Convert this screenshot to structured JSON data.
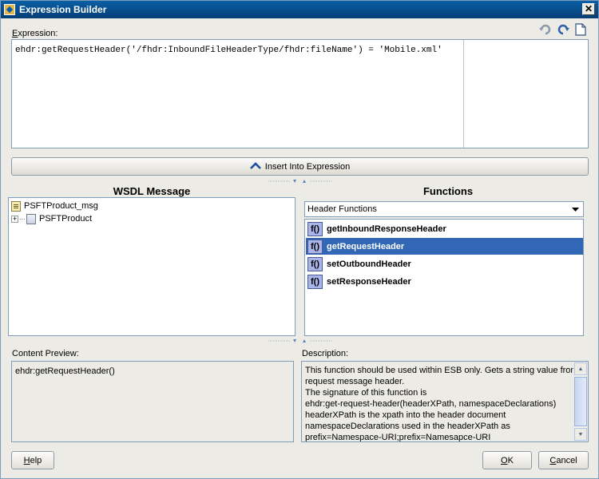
{
  "window": {
    "title": "Expression Builder",
    "close_glyph": "✕"
  },
  "expression": {
    "label": "Expression:",
    "value": "ehdr:getRequestHeader('/fhdr:InboundFileHeaderType/fhdr:fileName') = 'Mobile.xml'",
    "toolbar_icons": [
      "undo-icon",
      "redo-icon",
      "new-document-icon"
    ]
  },
  "insert_button": {
    "label": "Insert Into Expression",
    "icon": "chevron-up-icon"
  },
  "wsdl": {
    "title": "WSDL Message",
    "tree": [
      {
        "label": "PSFTProduct_msg",
        "icon": "message-icon"
      },
      {
        "label": "PSFTProduct",
        "icon": "part-icon",
        "expander": "+"
      }
    ]
  },
  "functions": {
    "title": "Functions",
    "category": "Header Functions",
    "fx_glyph": "f()",
    "items": [
      {
        "label": "getInboundResponseHeader",
        "selected": false
      },
      {
        "label": "getRequestHeader",
        "selected": true
      },
      {
        "label": "setOutboundHeader",
        "selected": false
      },
      {
        "label": "setResponseHeader",
        "selected": false
      }
    ]
  },
  "content_preview": {
    "label": "Content Preview:",
    "value": "ehdr:getRequestHeader()"
  },
  "description": {
    "label": "Description:",
    "lines": [
      "This function should be used within ESB only. Gets a string value from",
      "request message header.",
      "The signature of this function is",
      "ehdr:get-request-header(headerXPath, namespaceDeclarations)",
      " headerXPath is the xpath into the header document",
      " namespaceDeclarations used in the headerXPath as",
      "prefix=Namespace-URI;prefix=Namesapce-URI"
    ]
  },
  "buttons": {
    "help": {
      "label": "Help",
      "mnemonic": "H",
      "rest": "elp"
    },
    "ok": {
      "label": "OK",
      "mnemonic": "O",
      "rest": "K"
    },
    "cancel": {
      "label": "Cancel",
      "mnemonic": "C",
      "rest": "ancel"
    }
  }
}
